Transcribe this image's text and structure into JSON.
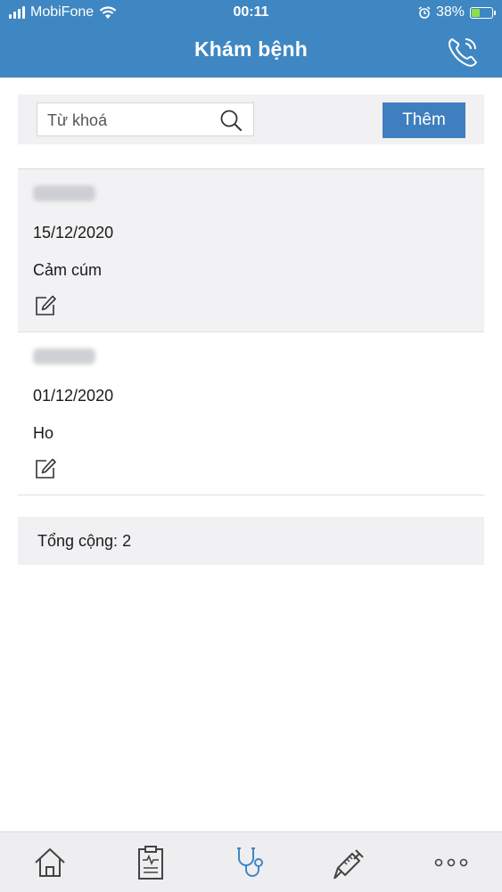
{
  "status_bar": {
    "carrier": "MobiFone",
    "time": "00:11",
    "battery_percent": "38%",
    "battery_level": 0.38
  },
  "header": {
    "title": "Khám bệnh"
  },
  "search": {
    "placeholder": "Từ khoá",
    "add_label": "Thêm"
  },
  "records": [
    {
      "date": "15/12/2020",
      "diagnosis": "Cảm cúm"
    },
    {
      "date": "01/12/2020",
      "diagnosis": "Ho"
    }
  ],
  "footer": {
    "total_label": "Tổng cộng: 2"
  },
  "tabbar": {
    "tabs": [
      "home-icon",
      "clipboard-icon",
      "stethoscope-icon",
      "syringe-icon",
      "more-icon"
    ],
    "active_tab": "stethoscope-icon"
  },
  "colors": {
    "header": "#3f87c2",
    "accent": "#3f7fc0",
    "active_tab": "#3f87c2"
  }
}
